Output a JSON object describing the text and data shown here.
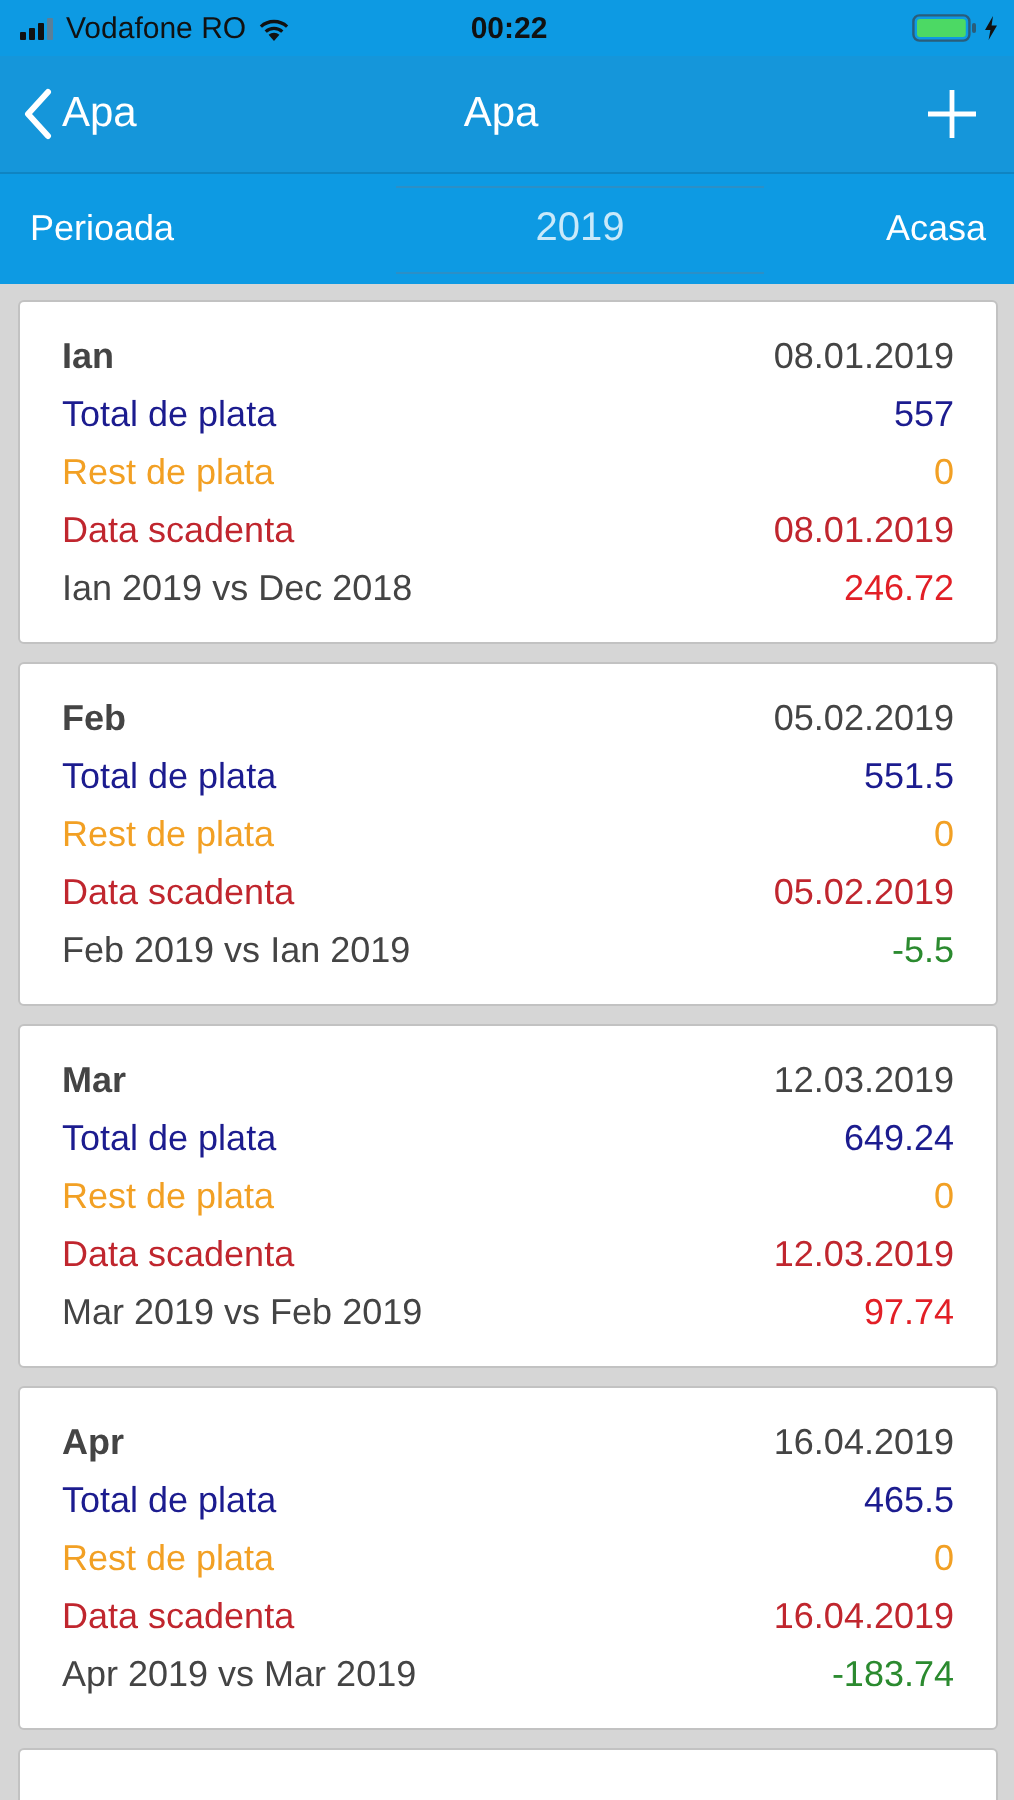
{
  "status_bar": {
    "carrier": "Vodafone RO",
    "time": "00:22"
  },
  "nav": {
    "back": "Apa",
    "title": "Apa"
  },
  "filter": {
    "left": "Perioada",
    "year": "2019",
    "right": "Acasa"
  },
  "cards": [
    {
      "month": "Ian",
      "date": "08.01.2019",
      "rows": [
        {
          "kind": "total",
          "label": "Total de plata",
          "value": "557"
        },
        {
          "kind": "rest",
          "label": "Rest de plata",
          "value": "0"
        },
        {
          "kind": "due",
          "label": "Data scadenta",
          "value": "08.01.2019"
        },
        {
          "kind": "compare",
          "label": "Ian 2019 vs Dec 2018",
          "value": "246.72",
          "color": "#e21f26"
        }
      ]
    },
    {
      "month": "Feb",
      "date": "05.02.2019",
      "rows": [
        {
          "kind": "total",
          "label": "Total de plata",
          "value": "551.5"
        },
        {
          "kind": "rest",
          "label": "Rest de plata",
          "value": "0"
        },
        {
          "kind": "due",
          "label": "Data scadenta",
          "value": "05.02.2019"
        },
        {
          "kind": "compare",
          "label": "Feb 2019 vs Ian 2019",
          "value": "-5.5",
          "color": "#2b8a2f"
        }
      ]
    },
    {
      "month": "Mar",
      "date": "12.03.2019",
      "rows": [
        {
          "kind": "total",
          "label": "Total de plata",
          "value": "649.24"
        },
        {
          "kind": "rest",
          "label": "Rest de plata",
          "value": "0"
        },
        {
          "kind": "due",
          "label": "Data scadenta",
          "value": "12.03.2019"
        },
        {
          "kind": "compare",
          "label": "Mar 2019 vs Feb 2019",
          "value": "97.74",
          "color": "#e21f26"
        }
      ]
    },
    {
      "month": "Apr",
      "date": "16.04.2019",
      "rows": [
        {
          "kind": "total",
          "label": "Total de plata",
          "value": "465.5"
        },
        {
          "kind": "rest",
          "label": "Rest de plata",
          "value": "0"
        },
        {
          "kind": "due",
          "label": "Data scadenta",
          "value": "16.04.2019"
        },
        {
          "kind": "compare",
          "label": "Apr 2019 vs Mar 2019",
          "value": "-183.74",
          "color": "#2b8a2f"
        }
      ]
    }
  ],
  "more_below": true
}
